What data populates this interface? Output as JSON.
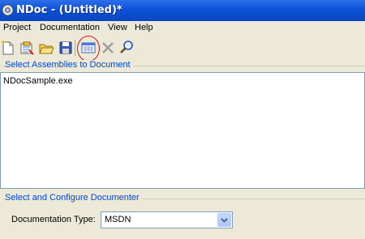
{
  "window": {
    "title": "NDoc - (Untitled)*"
  },
  "menu": {
    "items": [
      "Project",
      "Documentation",
      "View",
      "Help"
    ]
  },
  "toolbar": {
    "buttons": [
      "new-project-icon",
      "open-project-icon",
      "open-folder-icon",
      "save-icon",
      "build-documentation-icon",
      "cancel-build-icon",
      "view-documentation-icon"
    ]
  },
  "assemblies": {
    "group_label": "Select Assemblies to Document",
    "items": [
      "NDocSample.exe"
    ]
  },
  "documenter": {
    "group_label": "Select and Configure Documenter",
    "type_label": "Documentation Type:",
    "type_value": "MSDN"
  }
}
